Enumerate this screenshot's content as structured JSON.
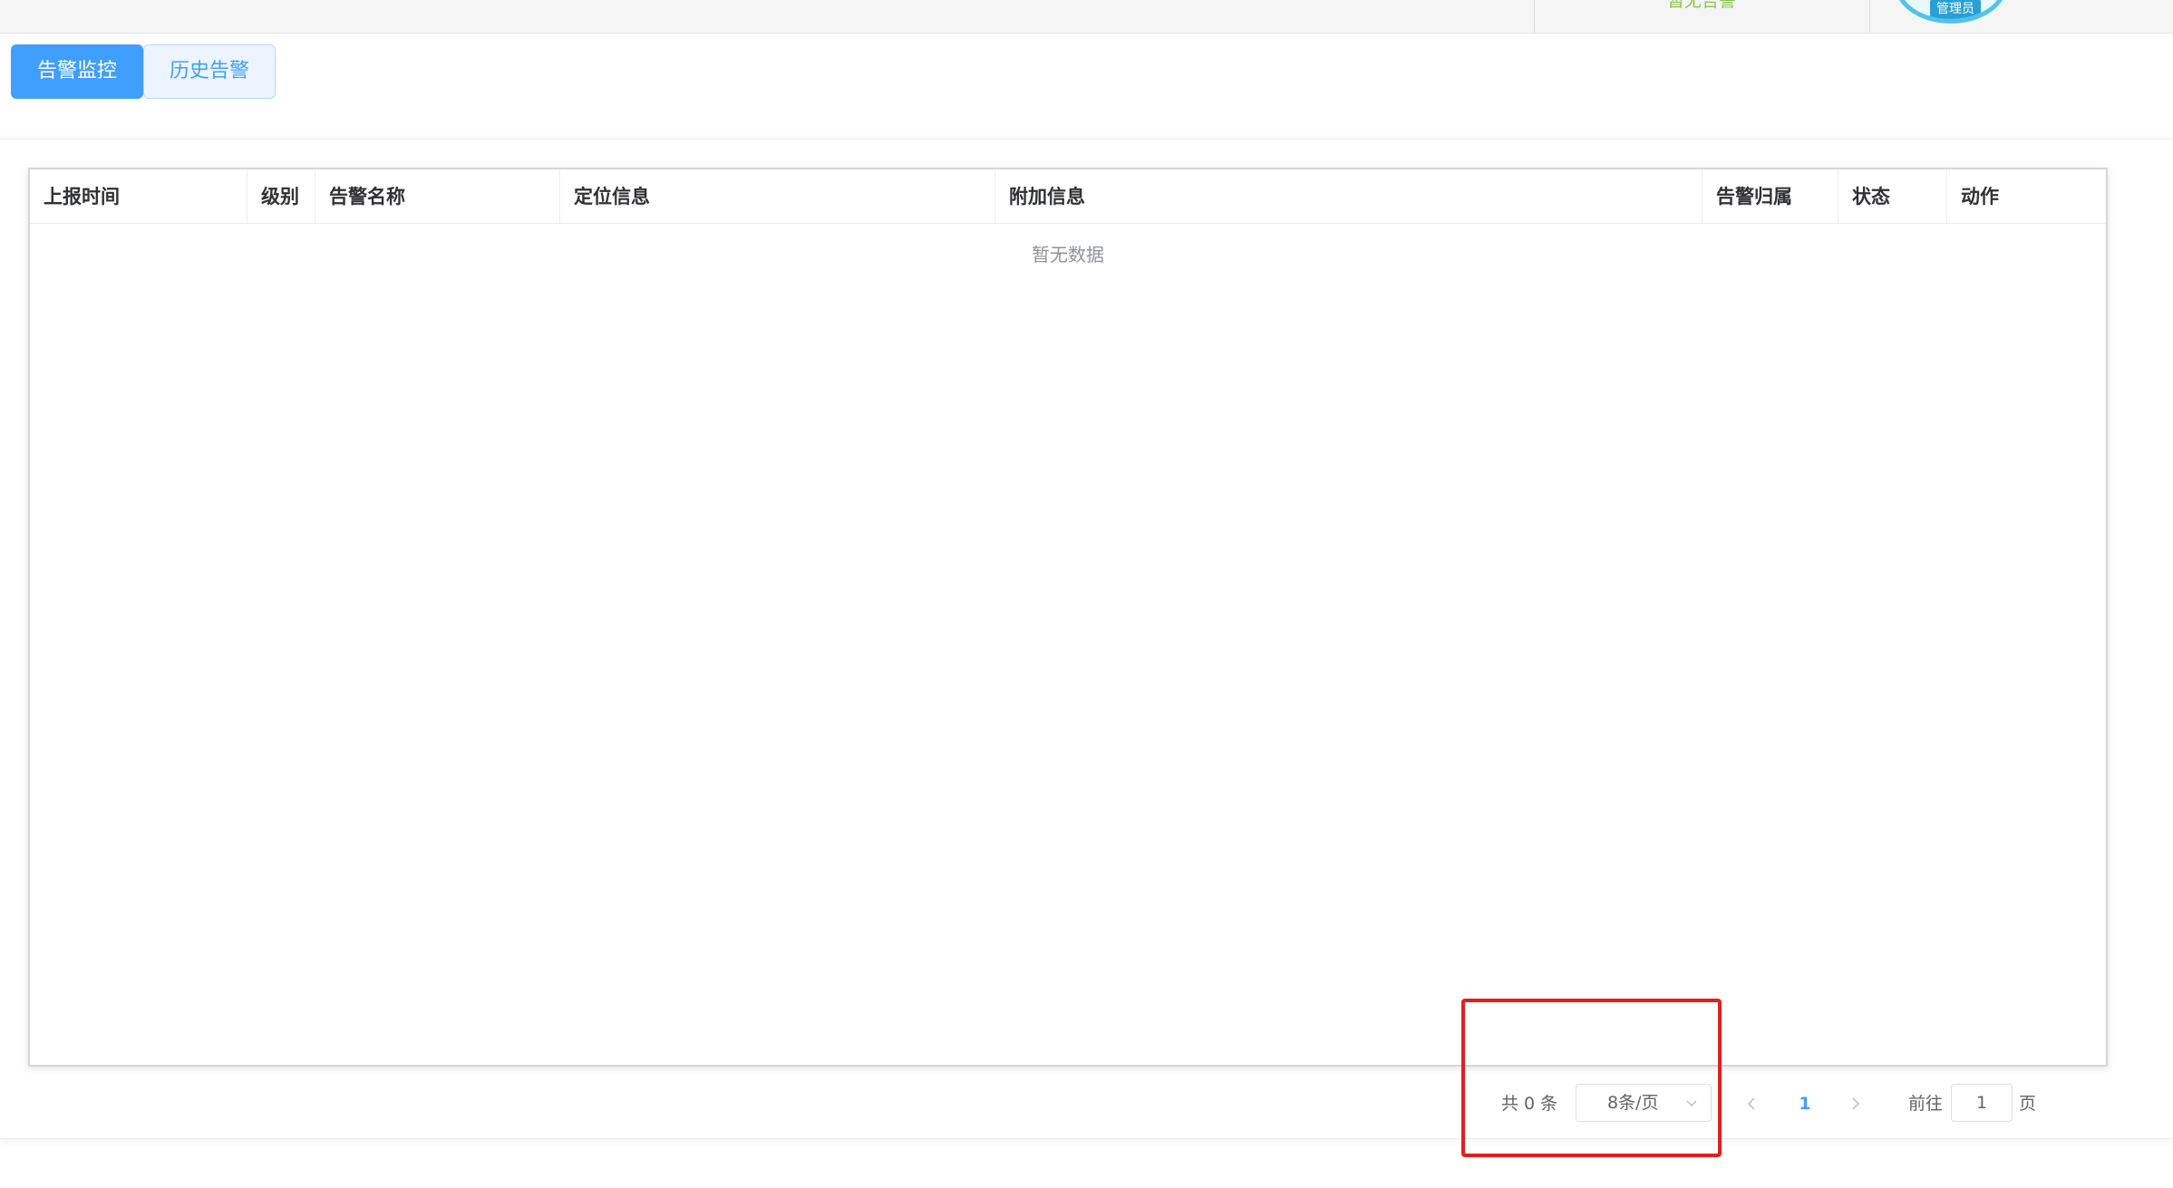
{
  "header": {
    "alarm_status": "暂无告警",
    "user_role": "管理员"
  },
  "tabs": [
    {
      "label": "告警监控",
      "active": true
    },
    {
      "label": "历史告警",
      "active": false
    }
  ],
  "table": {
    "columns": [
      "上报时间",
      "级别",
      "告警名称",
      "定位信息",
      "附加信息",
      "告警归属",
      "状态",
      "动作"
    ],
    "rows": [],
    "empty_text": "暂无数据"
  },
  "pagination": {
    "total_text": "共 0 条",
    "page_size": "8条/页",
    "current_page": "1",
    "goto_label": "前往",
    "goto_value": "1",
    "page_suffix": "页"
  },
  "colors": {
    "primary": "#409eff",
    "alarm_ok": "#8bc34a",
    "highlight": "#e02020"
  }
}
